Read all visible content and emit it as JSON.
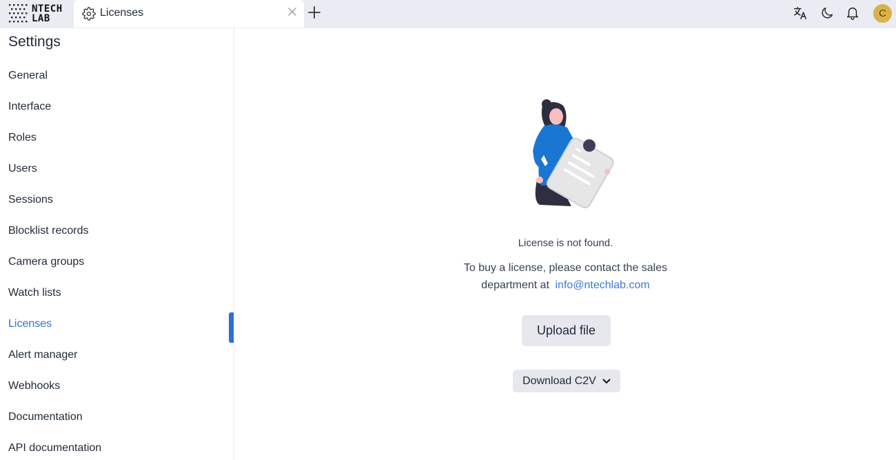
{
  "brand": {
    "line1": "NTECH",
    "line2": "LAB"
  },
  "tab": {
    "label": "Licenses",
    "icon": "gear-icon"
  },
  "topbar": {
    "icons": [
      "translate-icon",
      "moon-icon",
      "bell-icon"
    ],
    "avatar_letter": "C",
    "avatar_color": "#d9b24a"
  },
  "sidebar": {
    "title": "Settings",
    "items": [
      {
        "label": "General"
      },
      {
        "label": "Interface"
      },
      {
        "label": "Roles"
      },
      {
        "label": "Users"
      },
      {
        "label": "Sessions"
      },
      {
        "label": "Blocklist records"
      },
      {
        "label": "Camera groups"
      },
      {
        "label": "Watch lists"
      },
      {
        "label": "Licenses",
        "active": true
      },
      {
        "label": "Alert manager"
      },
      {
        "label": "Webhooks"
      },
      {
        "label": "Documentation"
      },
      {
        "label": "API documentation"
      }
    ]
  },
  "main": {
    "message_not_found": "License is not found.",
    "message_contact": "To buy a license, please contact the sales",
    "message_department": "department at",
    "email": "info@ntechlab.com",
    "upload_label": "Upload file",
    "download_label": "Download C2V"
  },
  "colors": {
    "accent": "#2f6fd6",
    "link": "#3b7bd6",
    "topbar_bg": "#e9ecf2",
    "button_bg": "#e6e8ee"
  }
}
